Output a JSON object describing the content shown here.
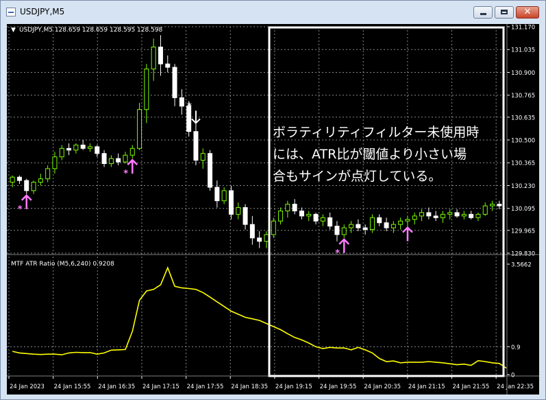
{
  "window": {
    "title": "USDJPY,M5",
    "min_icon": "minimize-icon",
    "max_icon": "maximize-icon",
    "close_icon": "close-icon",
    "close_glyph": "✕"
  },
  "colors": {
    "background": "#000000",
    "grid": "#8a8a8a",
    "bull_candle": "#7cfc00",
    "bear_candle": "#ffffff",
    "indicator_line": "#ffff00",
    "buy_signal": "#ff7cff",
    "sell_signal": "#ffffff",
    "annotation_box": "#ffffff",
    "text": "#ffffff"
  },
  "price_panel": {
    "header_arrow": "▼",
    "header": "USDJPY,M5  128.659 128.659 128.595 128.598"
  },
  "indicator_panel": {
    "header": "MTF ATR Ratio  (M5,6,240) 0.9208"
  },
  "annotation": {
    "lines": [
      "ボラティリティフィルター未使用時",
      "には、ATR比が閾値より小さい場",
      "合もサインが点灯している。"
    ]
  },
  "chart_data": [
    {
      "type": "candlestick",
      "symbol": "USDJPY,M5",
      "ylim": [
        129.83,
        131.17
      ],
      "y_ticks": [
        "131.170",
        "131.035",
        "130.900",
        "130.765",
        "130.635",
        "130.500",
        "130.365",
        "130.230",
        "130.095",
        "129.965",
        "129.830"
      ],
      "x_ticks": [
        "24 Jan 2023",
        "24 Jan 15:55",
        "24 Jan 16:35",
        "24 Jan 17:15",
        "24 Jan 17:55",
        "24 Jan 18:35",
        "24 Jan 19:15",
        "24 Jan 19:55",
        "24 Jan 20:35",
        "24 Jan 21:15",
        "24 Jan 21:55",
        "24 Jan 22:35"
      ],
      "grid": true,
      "candles": [
        {
          "o": 130.25,
          "h": 130.29,
          "l": 130.22,
          "c": 130.28
        },
        {
          "o": 130.28,
          "h": 130.29,
          "l": 130.24,
          "c": 130.26
        },
        {
          "o": 130.26,
          "h": 130.27,
          "l": 130.18,
          "c": 130.2
        },
        {
          "o": 130.2,
          "h": 130.26,
          "l": 130.18,
          "c": 130.25
        },
        {
          "o": 130.25,
          "h": 130.3,
          "l": 130.23,
          "c": 130.27
        },
        {
          "o": 130.27,
          "h": 130.35,
          "l": 130.25,
          "c": 130.33
        },
        {
          "o": 130.33,
          "h": 130.43,
          "l": 130.3,
          "c": 130.4
        },
        {
          "o": 130.4,
          "h": 130.47,
          "l": 130.38,
          "c": 130.45
        },
        {
          "o": 130.45,
          "h": 130.48,
          "l": 130.41,
          "c": 130.44
        },
        {
          "o": 130.44,
          "h": 130.48,
          "l": 130.42,
          "c": 130.47
        },
        {
          "o": 130.47,
          "h": 130.5,
          "l": 130.44,
          "c": 130.45
        },
        {
          "o": 130.45,
          "h": 130.48,
          "l": 130.43,
          "c": 130.46
        },
        {
          "o": 130.46,
          "h": 130.47,
          "l": 130.4,
          "c": 130.42
        },
        {
          "o": 130.42,
          "h": 130.44,
          "l": 130.34,
          "c": 130.36
        },
        {
          "o": 130.36,
          "h": 130.41,
          "l": 130.34,
          "c": 130.39
        },
        {
          "o": 130.39,
          "h": 130.42,
          "l": 130.35,
          "c": 130.37
        },
        {
          "o": 130.37,
          "h": 130.43,
          "l": 130.36,
          "c": 130.41
        },
        {
          "o": 130.41,
          "h": 130.47,
          "l": 130.39,
          "c": 130.45
        },
        {
          "o": 130.45,
          "h": 130.72,
          "l": 130.44,
          "c": 130.68
        },
        {
          "o": 130.68,
          "h": 130.95,
          "l": 130.6,
          "c": 130.92
        },
        {
          "o": 130.92,
          "h": 131.1,
          "l": 130.85,
          "c": 131.05
        },
        {
          "o": 131.05,
          "h": 131.12,
          "l": 130.88,
          "c": 130.95
        },
        {
          "o": 130.95,
          "h": 131.0,
          "l": 130.9,
          "c": 130.93
        },
        {
          "o": 130.93,
          "h": 130.95,
          "l": 130.7,
          "c": 130.75
        },
        {
          "o": 130.75,
          "h": 130.8,
          "l": 130.65,
          "c": 130.7
        },
        {
          "o": 130.7,
          "h": 130.73,
          "l": 130.52,
          "c": 130.55
        },
        {
          "o": 130.55,
          "h": 130.6,
          "l": 130.35,
          "c": 130.38
        },
        {
          "o": 130.38,
          "h": 130.45,
          "l": 130.33,
          "c": 130.42
        },
        {
          "o": 130.42,
          "h": 130.44,
          "l": 130.2,
          "c": 130.22
        },
        {
          "o": 130.22,
          "h": 130.26,
          "l": 130.1,
          "c": 130.14
        },
        {
          "o": 130.14,
          "h": 130.22,
          "l": 130.12,
          "c": 130.2
        },
        {
          "o": 130.2,
          "h": 130.23,
          "l": 130.03,
          "c": 130.06
        },
        {
          "o": 130.06,
          "h": 130.13,
          "l": 130.03,
          "c": 130.1
        },
        {
          "o": 130.1,
          "h": 130.12,
          "l": 129.97,
          "c": 130.0
        },
        {
          "o": 130.0,
          "h": 130.05,
          "l": 129.88,
          "c": 129.92
        },
        {
          "o": 129.92,
          "h": 129.96,
          "l": 129.86,
          "c": 129.9
        },
        {
          "o": 129.9,
          "h": 129.96,
          "l": 129.86,
          "c": 129.94
        },
        {
          "o": 129.94,
          "h": 130.04,
          "l": 129.92,
          "c": 130.02
        },
        {
          "o": 130.02,
          "h": 130.1,
          "l": 130.0,
          "c": 130.08
        },
        {
          "o": 130.08,
          "h": 130.14,
          "l": 130.04,
          "c": 130.12
        },
        {
          "o": 130.12,
          "h": 130.15,
          "l": 130.06,
          "c": 130.08
        },
        {
          "o": 130.08,
          "h": 130.1,
          "l": 130.03,
          "c": 130.05
        },
        {
          "o": 130.05,
          "h": 130.08,
          "l": 130.02,
          "c": 130.06
        },
        {
          "o": 130.06,
          "h": 130.07,
          "l": 130.0,
          "c": 130.02
        },
        {
          "o": 130.02,
          "h": 130.06,
          "l": 129.99,
          "c": 130.04
        },
        {
          "o": 130.04,
          "h": 130.07,
          "l": 129.97,
          "c": 129.99
        },
        {
          "o": 129.99,
          "h": 130.02,
          "l": 129.9,
          "c": 129.94
        },
        {
          "o": 129.94,
          "h": 130.0,
          "l": 129.92,
          "c": 129.98
        },
        {
          "o": 129.98,
          "h": 130.02,
          "l": 129.95,
          "c": 130.0
        },
        {
          "o": 130.0,
          "h": 130.03,
          "l": 129.96,
          "c": 129.98
        },
        {
          "o": 129.98,
          "h": 130.0,
          "l": 129.94,
          "c": 129.97
        },
        {
          "o": 129.97,
          "h": 130.06,
          "l": 129.95,
          "c": 130.04
        },
        {
          "o": 130.04,
          "h": 130.06,
          "l": 129.99,
          "c": 130.01
        },
        {
          "o": 130.01,
          "h": 130.04,
          "l": 129.96,
          "c": 129.98
        },
        {
          "o": 129.98,
          "h": 130.02,
          "l": 129.95,
          "c": 130.0
        },
        {
          "o": 130.0,
          "h": 130.04,
          "l": 129.97,
          "c": 130.02
        },
        {
          "o": 130.02,
          "h": 130.05,
          "l": 129.99,
          "c": 130.03
        },
        {
          "o": 130.03,
          "h": 130.07,
          "l": 130.0,
          "c": 130.05
        },
        {
          "o": 130.05,
          "h": 130.09,
          "l": 130.02,
          "c": 130.07
        },
        {
          "o": 130.07,
          "h": 130.1,
          "l": 130.03,
          "c": 130.05
        },
        {
          "o": 130.05,
          "h": 130.08,
          "l": 130.02,
          "c": 130.04
        },
        {
          "o": 130.04,
          "h": 130.08,
          "l": 130.01,
          "c": 130.06
        },
        {
          "o": 130.06,
          "h": 130.09,
          "l": 130.03,
          "c": 130.07
        },
        {
          "o": 130.07,
          "h": 130.09,
          "l": 130.04,
          "c": 130.05
        },
        {
          "o": 130.05,
          "h": 130.08,
          "l": 130.03,
          "c": 130.06
        },
        {
          "o": 130.06,
          "h": 130.08,
          "l": 130.03,
          "c": 130.04
        },
        {
          "o": 130.04,
          "h": 130.07,
          "l": 130.02,
          "c": 130.06
        },
        {
          "o": 130.06,
          "h": 130.13,
          "l": 130.05,
          "c": 130.11
        },
        {
          "o": 130.11,
          "h": 130.14,
          "l": 130.08,
          "c": 130.12
        },
        {
          "o": 130.12,
          "h": 130.14,
          "l": 130.09,
          "c": 130.11
        },
        {
          "o": 130.11,
          "h": 130.14,
          "l": 130.09,
          "c": 130.13
        }
      ],
      "signals": [
        {
          "index": 2,
          "direction": "buy",
          "label": "*"
        },
        {
          "index": 17,
          "direction": "buy",
          "label": "*"
        },
        {
          "index": 26,
          "direction": "sell",
          "label": "*"
        },
        {
          "index": 47,
          "direction": "buy",
          "label": "*"
        },
        {
          "index": 56,
          "direction": "buy",
          "label": ""
        }
      ]
    },
    {
      "type": "line",
      "title": "MTF ATR Ratio",
      "series": [
        {
          "name": "MTF ATR Ratio",
          "values": [
            0.75,
            0.7,
            0.68,
            0.66,
            0.65,
            0.66,
            0.66,
            0.64,
            0.7,
            0.72,
            0.71,
            0.71,
            0.66,
            0.7,
            0.79,
            0.8,
            0.81,
            1.4,
            2.4,
            2.7,
            2.75,
            2.9,
            3.45,
            2.85,
            2.8,
            2.78,
            2.75,
            2.65,
            2.5,
            2.35,
            2.2,
            2.05,
            1.95,
            1.85,
            1.8,
            1.75,
            1.65,
            1.55,
            1.45,
            1.32,
            1.2,
            1.12,
            1.02,
            0.9,
            0.84,
            0.88,
            0.86,
            0.86,
            0.8,
            0.88,
            0.8,
            0.7,
            0.52,
            0.42,
            0.44,
            0.38,
            0.4,
            0.4,
            0.4,
            0.42,
            0.4,
            0.38,
            0.35,
            0.32,
            0.34,
            0.3,
            0.45,
            0.42,
            0.38,
            0.36,
            0.21
          ]
        }
      ],
      "ylim": [
        0,
        3.5662
      ],
      "y_ticks": [
        "3.5662",
        "0.9",
        "0"
      ],
      "levels": [
        0.9
      ]
    }
  ]
}
